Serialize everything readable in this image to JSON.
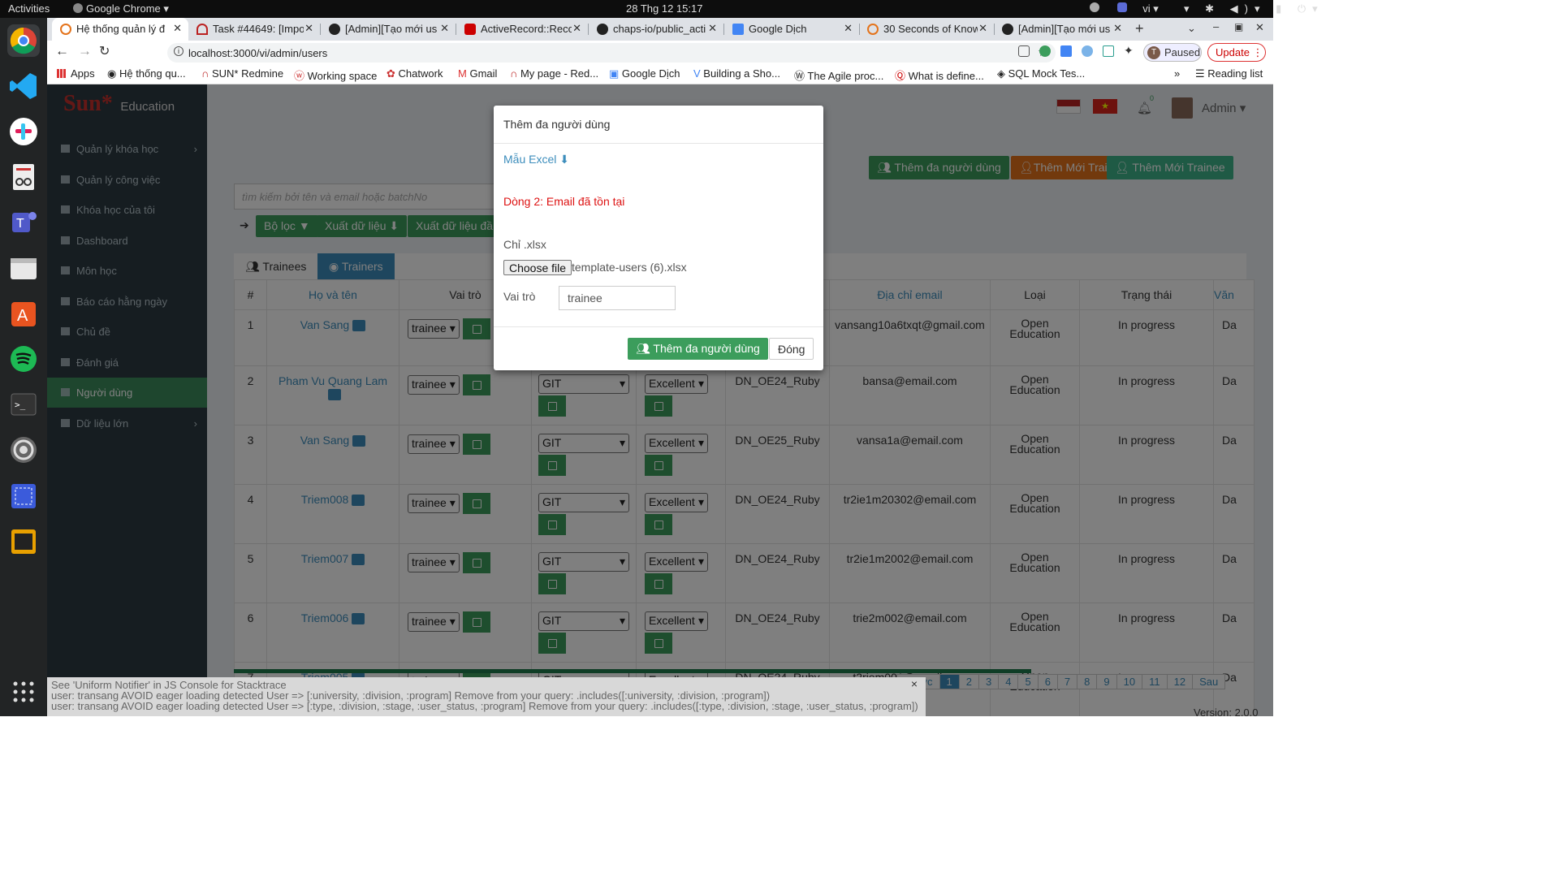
{
  "system_bar": {
    "activities": "Activities",
    "app_menu": "Google Chrome",
    "datetime": "28 Thg 12  15:17",
    "lang": "vi"
  },
  "tabs": [
    {
      "label": "Hệ thống quản lý đ",
      "active": true
    },
    {
      "label": "Task #44649: [Impor"
    },
    {
      "label": "[Admin][Tạo mới us"
    },
    {
      "label": "ActiveRecord::Recor"
    },
    {
      "label": "chaps-io/public_acti"
    },
    {
      "label": "Google Dịch"
    },
    {
      "label": "30 Seconds of Know"
    },
    {
      "label": "[Admin][Tạo mới us"
    }
  ],
  "toolbar": {
    "url": "localhost:3000/vi/admin/users",
    "profile": "Paused",
    "update": "Update",
    "profile_initial": "T"
  },
  "bookmarks": [
    "Apps",
    "Hệ thống qu...",
    "SUN* Redmine",
    "Working space",
    "Chatwork",
    "Gmail",
    "My page - Red...",
    "Google Dịch",
    "Building a Sho...",
    "The Agile proc...",
    "What is define...",
    "SQL Mock Tes..."
  ],
  "reading_list": "Reading list",
  "brand": {
    "logo": "Sun*",
    "sub": "Education"
  },
  "sidebar": [
    {
      "label": "Quản lý khóa học",
      "chevron": true
    },
    {
      "label": "Quản lý công việc"
    },
    {
      "label": "Khóa học của tôi"
    },
    {
      "label": "Dashboard"
    },
    {
      "label": "Môn học"
    },
    {
      "label": "Báo cáo hằng ngày"
    },
    {
      "label": "Chủ đề"
    },
    {
      "label": "Đánh giá"
    },
    {
      "label": "Người dùng",
      "active": true
    },
    {
      "label": "Dữ liệu lớn",
      "chevron": true
    }
  ],
  "header": {
    "user": "Admin",
    "bell_count": "0"
  },
  "actions": {
    "add_multi": "Thêm đa người dùng",
    "add_trainer": "Thêm Mới Trainer",
    "add_trainee": "Thêm Mới Trainee"
  },
  "search": {
    "placeholder": "tìm kiếm bởi tên và email hoặc batchNo"
  },
  "filter": {
    "filter": "Bộ lọc",
    "export": "Xuất dữ liệu",
    "export2": "Xuất dữ liệu đầ"
  },
  "role_tabs": {
    "trainees": "Trainees",
    "trainers": "Trainers"
  },
  "table": {
    "headers": [
      "#",
      "Họ và tên",
      "Vai trò",
      "",
      "",
      "",
      "Địa chỉ email",
      "Loại",
      "Trạng thái",
      "Văn"
    ],
    "rows": [
      {
        "no": "1",
        "name": "Van Sang",
        "role": "trainee",
        "tech": "",
        "level": "",
        "batch": "",
        "email": "vansang10a6txqt@gmail.com",
        "type": "Open Education",
        "status": "In progress",
        "office": "Da"
      },
      {
        "no": "2",
        "name": "Pham Vu Quang Lam",
        "role": "trainee",
        "tech": "GIT",
        "level": "Excellent",
        "batch": "DN_OE24_Ruby",
        "email": "bansa@email.com",
        "type": "Open Education",
        "status": "In progress",
        "office": "Da"
      },
      {
        "no": "3",
        "name": "Van Sang",
        "role": "trainee",
        "tech": "GIT",
        "level": "Excellent",
        "batch": "DN_OE25_Ruby",
        "email": "vansa1a@email.com",
        "type": "Open Education",
        "status": "In progress",
        "office": "Da"
      },
      {
        "no": "4",
        "name": "Triem008",
        "role": "trainee",
        "tech": "GIT",
        "level": "Excellent",
        "batch": "DN_OE24_Ruby",
        "email": "tr2ie1m20302@email.com",
        "type": "Open Education",
        "status": "In progress",
        "office": "Da"
      },
      {
        "no": "5",
        "name": "Triem007",
        "role": "trainee",
        "tech": "GIT",
        "level": "Excellent",
        "batch": "DN_OE24_Ruby",
        "email": "tr2ie1m2002@email.com",
        "type": "Open Education",
        "status": "In progress",
        "office": "Da"
      },
      {
        "no": "6",
        "name": "Triem006",
        "role": "trainee",
        "tech": "GIT",
        "level": "Excellent",
        "batch": "DN_OE24_Ruby",
        "email": "trie2m002@email.com",
        "type": "Open Education",
        "status": "In progress",
        "office": "Da"
      },
      {
        "no": "7",
        "name": "Triem005",
        "role": "trainee",
        "tech": "GIT",
        "level": "Excellent",
        "batch": "DN_OE24_Ruby",
        "email": "t2riem001@email.com",
        "type": "Open Education",
        "status": "In progress",
        "office": "Da"
      }
    ]
  },
  "pagination": {
    "prev": "Trước",
    "pages": [
      "1",
      "2",
      "3",
      "4",
      "5",
      "6",
      "7",
      "8",
      "9",
      "10",
      "11",
      "12"
    ],
    "next": "Sau"
  },
  "version": "Version: 2.0.0",
  "modal": {
    "title": "Thêm đa người dùng",
    "excel_link": "Mẫu Excel",
    "error": "Dòng 2: Email đã tồn tại",
    "only_xlsx": "Chỉ .xlsx",
    "choose_file": "Choose file",
    "file_name": "template-users (6).xlsx",
    "role_label": "Vai trò",
    "role_value": "trainee",
    "submit": "Thêm đa người dùng",
    "close": "Đóng"
  },
  "notifier": {
    "line1": "See 'Uniform Notifier' in JS Console for Stacktrace",
    "line2": "user: transang AVOID eager loading detected User => [:university, :division, :program] Remove from your query: .includes([:university, :division, :program])",
    "line3": "user: transang AVOID eager loading detected User => [:type, :division, :stage, :user_status, :program] Remove from your query: .includes([:type, :division, :stage, :user_status, :program])",
    "close": "×"
  },
  "colors": {
    "sidebar": "#2d3b43",
    "active": "#3c8d5c",
    "brand": "#c9302c",
    "link": "#3c8dbc",
    "error": "#dd1111",
    "orange": "#e4731b"
  }
}
